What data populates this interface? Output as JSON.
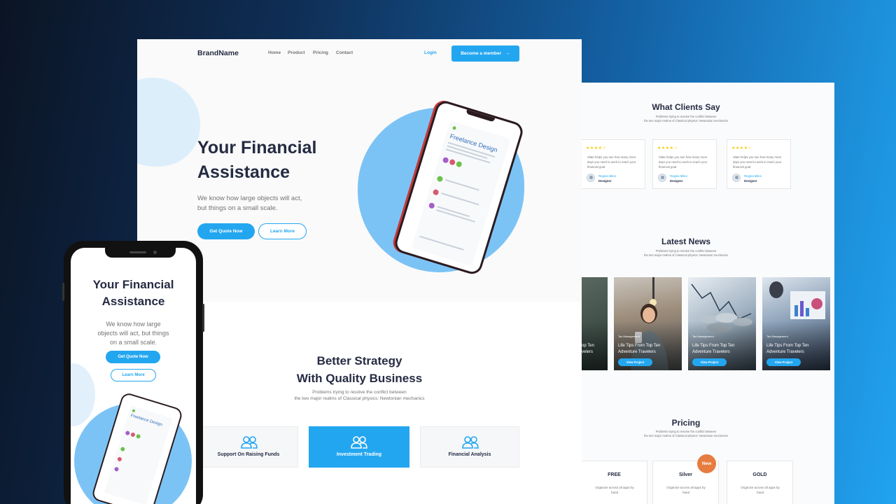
{
  "desktop": {
    "nav": {
      "brand": "BrandName",
      "links": [
        "Home",
        "Product",
        "Pricing",
        "Contact"
      ],
      "login": "Login",
      "cta": "Become a member",
      "cta_icon": "arrow-right-icon"
    },
    "hero": {
      "title_line1": "Your Financial",
      "title_line2": "Assistance",
      "desc_line1": "We know how large objects will act,",
      "desc_line2": "but things on a small scale.",
      "btn_primary": "Get Quote Now",
      "btn_secondary": "Learn More"
    },
    "strategy": {
      "title_line1": "Better Strategy",
      "title_line2": "With Quality Business",
      "sub_line1": "Problems trying to resolve the conflict between",
      "sub_line2": "the two major realms of Classical physics: Newtonian mechanics"
    },
    "features": [
      {
        "label": "Support On Raising Funds",
        "icon": "users-icon"
      },
      {
        "label": "Investment Trading",
        "icon": "users-icon"
      },
      {
        "label": "Financial Analysis",
        "icon": "users-icon"
      }
    ]
  },
  "mockup_app": {
    "title": "Freelance Design"
  },
  "back": {
    "clients": {
      "title": "What Clients Say",
      "sub_line1": "Problems trying to resolve the conflict between",
      "sub_line2": "the two major realms of Classical physics: Newtonian mechanics",
      "cards": [
        {
          "stars": "★★★★☆",
          "text": "Slate helps you see how many more days you need to work to reach your financial goal.",
          "name": "Regina Miles",
          "role": "Designer"
        },
        {
          "stars": "★★★★☆",
          "text": "Slate helps you see how many more days you need to work to reach your financial goal.",
          "name": "Regina Miles",
          "role": "Designer"
        },
        {
          "stars": "★★★★☆",
          "text": "Slate helps you see how many more days you need to work to reach your financial goal.",
          "name": "Regina Miles",
          "role": "Designer"
        }
      ]
    },
    "news": {
      "title": "Latest News",
      "sub_line1": "Problems trying to resolve the conflict between",
      "sub_line2": "the two major realms of Classical physics: Newtonian mechanics",
      "partial_title": "op Ten\nvelers",
      "cards": [
        {
          "tag": "Tax Management",
          "title": "Life Tips From Top Ten Adventure Travelers",
          "button": "View Project"
        },
        {
          "tag": "Tax Management",
          "title": "Life Tips From Top Ten Adventure Travelers",
          "button": "View Project"
        },
        {
          "tag": "Tax Management",
          "title": "Life Tips From Top Ten Adventure Travelers",
          "button": "View Project"
        }
      ]
    },
    "pricing": {
      "title": "Pricing",
      "sub_line1": "Problems trying to resolve the conflict between",
      "sub_line2": "the two major realms of Classical physics: Newtonian mechanics",
      "badge": "New",
      "plans": [
        {
          "name": "FREE",
          "desc": "Organize across all apps by hand"
        },
        {
          "name": "Silver",
          "desc": "Organize across all apps by hand"
        },
        {
          "name": "GOLD",
          "desc": "Organize across all apps by hand"
        }
      ]
    }
  },
  "mobile": {
    "title_line1": "Your Financial",
    "title_line2": "Assistance",
    "desc_line1": "We know how large",
    "desc_line2": "objects will act, but things",
    "desc_line3": "on a small scale.",
    "btn_primary": "Get Quote Now",
    "btn_secondary": "Learn More"
  },
  "colors": {
    "accent": "#23A6F0",
    "heading": "#252B42",
    "muted": "#737373",
    "badge": "#E77C40",
    "star": "#F3CD03"
  }
}
